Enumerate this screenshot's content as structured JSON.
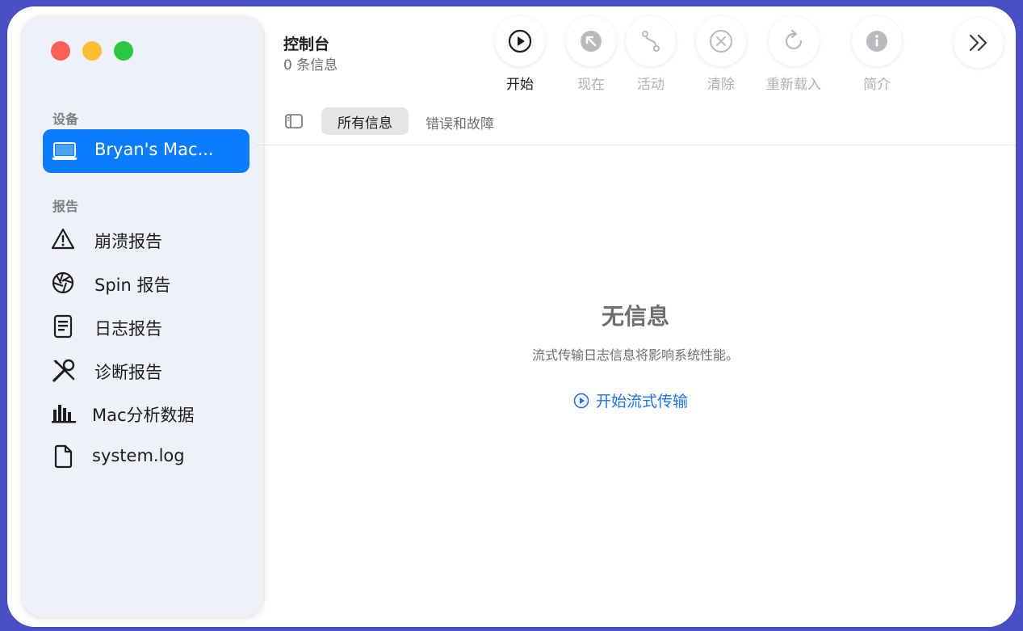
{
  "window": {
    "title": "控制台",
    "subtitle": "0 条信息"
  },
  "sidebar": {
    "devices_header": "设备",
    "device": {
      "label": "Bryan's Mac...",
      "icon": "laptop-icon"
    },
    "reports_header": "报告",
    "items": [
      {
        "label": "崩溃报告",
        "icon": "warning-triangle-icon"
      },
      {
        "label": "Spin 报告",
        "icon": "aperture-icon"
      },
      {
        "label": "日志报告",
        "icon": "document-lines-icon"
      },
      {
        "label": "诊断报告",
        "icon": "wrench-screwdriver-icon"
      },
      {
        "label": "Mac分析数据",
        "icon": "bar-chart-icon"
      },
      {
        "label": "system.log",
        "icon": "file-icon"
      }
    ]
  },
  "toolbar": {
    "start": "开始",
    "now": "现在",
    "activity": "活动",
    "clear": "清除",
    "reload": "重新载入",
    "info": "简介"
  },
  "filter": {
    "all_messages": "所有信息",
    "errors_faults": "错误和故障"
  },
  "empty_state": {
    "title": "无信息",
    "description": "流式传输日志信息将影响系统性能。",
    "start_streaming": "开始流式传输"
  },
  "colors": {
    "accent": "#0a7dff",
    "link": "#1a73e8",
    "traffic_red": "#fe5f57",
    "traffic_yellow": "#febc2e",
    "traffic_green": "#28c840",
    "background": "#4b4fc7"
  }
}
